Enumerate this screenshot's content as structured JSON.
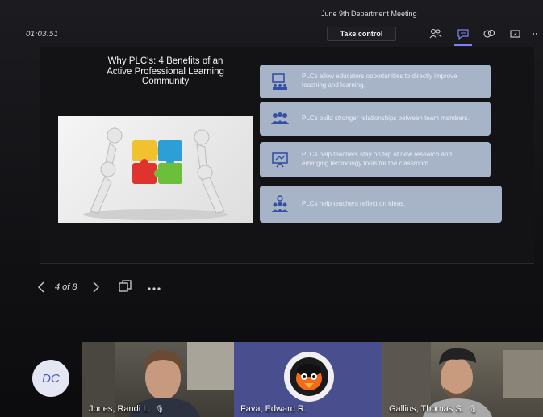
{
  "meeting": {
    "title": "June 9th Department Meeting",
    "timer": "01:03:51",
    "take_control_label": "Take control"
  },
  "toolbar_icons": [
    "people-icon",
    "chat-icon",
    "reactions-icon",
    "share-tray-icon",
    "more-icon"
  ],
  "slide": {
    "title": "Why PLC's:  4 Benefits of an Active Professional Learning Community",
    "benefits": [
      {
        "icon": "classroom-icon",
        "text": "PLCs allow educators opportunities to directly improve teaching and learning."
      },
      {
        "icon": "group-icon",
        "text": "PLCs build stronger relationships between team members."
      },
      {
        "icon": "presentation-icon",
        "text": "PLCs help teachers stay on top of new research and emerging technology tools for the classroom."
      },
      {
        "icon": "idea-group-icon",
        "text": "PLCs help teachers reflect on ideas."
      }
    ]
  },
  "navigation": {
    "page_indicator": "4 of 8"
  },
  "self": {
    "initials": "DC"
  },
  "participants": [
    {
      "name": "Jones, Randi L."
    },
    {
      "name": "Fava, Edward R."
    },
    {
      "name": "Gallius, Thomas S."
    }
  ]
}
